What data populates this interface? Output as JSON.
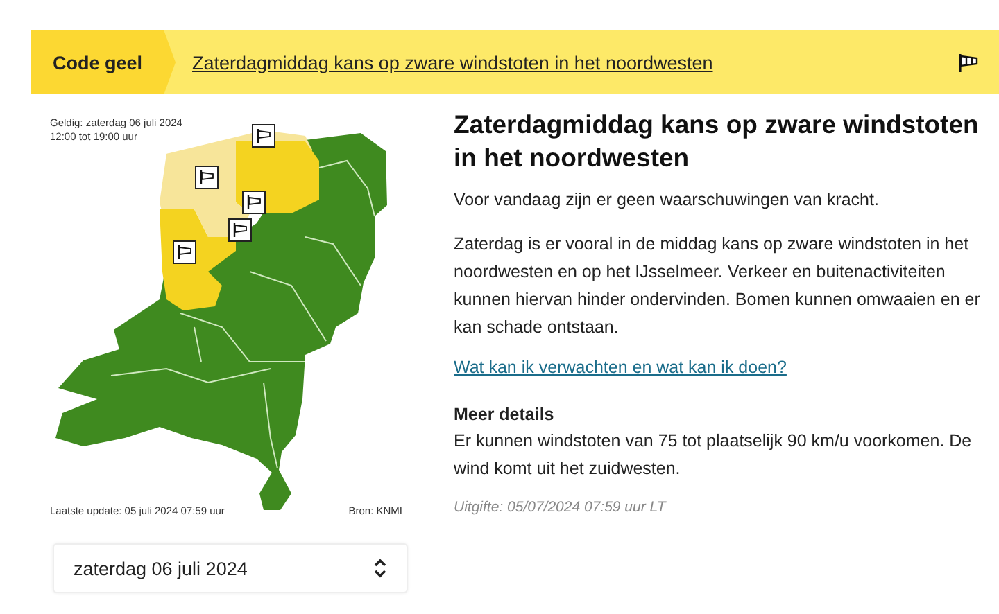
{
  "banner": {
    "level_label": "Code geel",
    "headline": "Zaterdagmiddag kans op zware windstoten in het noordwesten"
  },
  "map": {
    "valid_line1": "Geldig: zaterdag 06 juli 2024",
    "valid_line2": "12:00 tot 19:00 uur",
    "updated": "Laatste update: 05 juli 2024 07:59 uur",
    "source": "Bron: KNMI"
  },
  "date_select": {
    "value": "zaterdag 06 juli 2024"
  },
  "article": {
    "title": "Zaterdagmiddag kans op zware windstoten in het noordwesten",
    "paragraphs": [
      "Voor vandaag zijn er geen waarschuwingen van kracht.",
      "Zaterdag is er vooral in de middag kans op zware windstoten in het noordwesten en op het IJsselmeer. Verkeer en buitenactiviteiten kunnen hiervan hinder ondervinden. Bomen kunnen omwaaien en er kan schade ontstaan."
    ],
    "link": "Wat kan ik verwachten en wat kan ik doen?",
    "details_heading": "Meer details",
    "details_text": "Er kunnen windstoten van 75 tot plaatselijk 90 km/u voorkomen. De wind komt uit het zuidwesten.",
    "issued": "Uitgifte: 05/07/2024 07:59 uur LT"
  }
}
